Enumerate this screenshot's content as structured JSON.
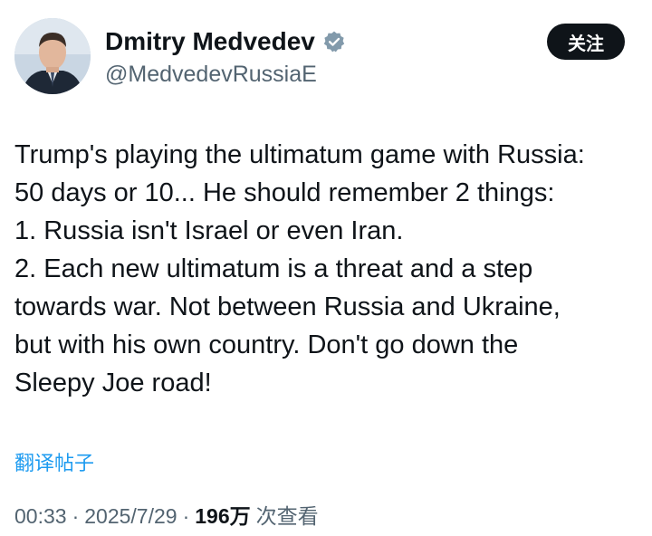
{
  "author": {
    "display_name": "Dmitry Medvedev",
    "handle": "@MedvedevRussiaE",
    "avatar": "profile-photo",
    "verified": "verified-badge-icon"
  },
  "actions": {
    "follow_label": "关注"
  },
  "tweet": {
    "lines": [
      "Trump's playing the ultimatum game with Russia:",
      "50 days or 10... He should remember 2 things:",
      "1. Russia isn't Israel or even Iran.",
      "2. Each new ultimatum is a threat and a step",
      "towards war. Not between Russia and Ukraine,",
      "but with his own country. Don't go down the",
      "Sleepy Joe road!"
    ]
  },
  "translate": {
    "label": "翻译帖子"
  },
  "meta": {
    "time": "00:33",
    "separator": "·",
    "date": "2025/7/29",
    "views_count": "196万",
    "views_label": "次查看"
  },
  "colors": {
    "text": "#0f1419",
    "secondary": "#536471",
    "link": "#1d9bf0",
    "verified": "#829aab",
    "button_bg": "#0f1419"
  }
}
